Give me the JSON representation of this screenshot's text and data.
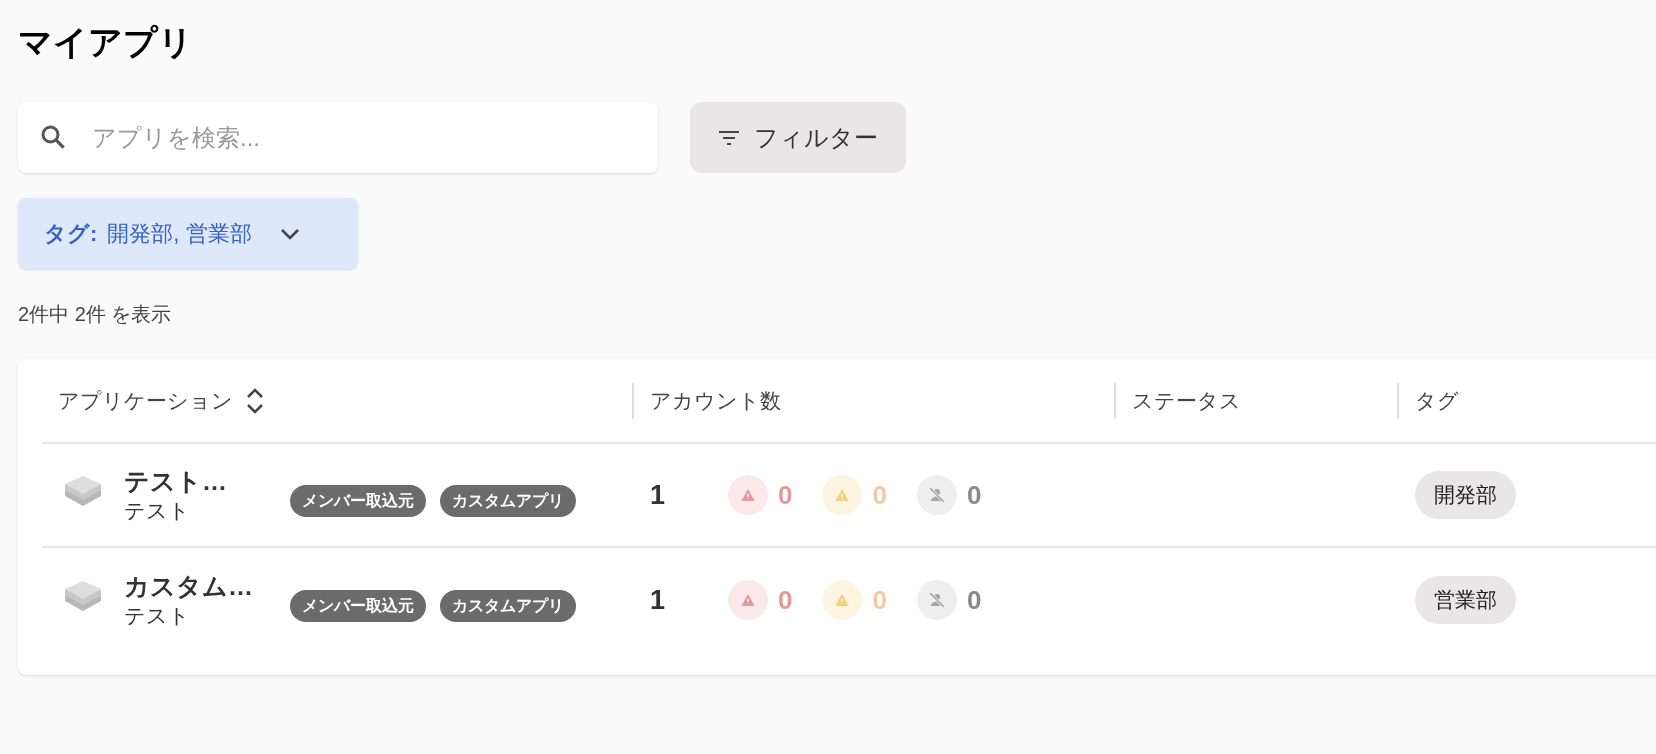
{
  "title": "マイアプリ",
  "search": {
    "placeholder": "アプリを検索..."
  },
  "filter_button": {
    "label": "フィルター"
  },
  "active_filter": {
    "label": "タグ:",
    "value": "開発部, 営業部"
  },
  "result_count": "2件中 2件 を表示",
  "table": {
    "columns": [
      "アプリケーション",
      "アカウント数",
      "ステータス",
      "タグ"
    ],
    "rows": [
      {
        "name": "テスト…",
        "subtitle": "テスト",
        "badges": [
          "メンバー取込元",
          "カスタムアプリ"
        ],
        "accounts": "1",
        "indicators": [
          {
            "kind": "error",
            "count": "0"
          },
          {
            "kind": "warning",
            "count": "0"
          },
          {
            "kind": "inactive",
            "count": "0"
          }
        ],
        "tag": "開発部"
      },
      {
        "name": "カスタム…",
        "subtitle": "テスト",
        "badges": [
          "メンバー取込元",
          "カスタムアプリ"
        ],
        "accounts": "1",
        "indicators": [
          {
            "kind": "error",
            "count": "0"
          },
          {
            "kind": "warning",
            "count": "0"
          },
          {
            "kind": "inactive",
            "count": "0"
          }
        ],
        "tag": "営業部"
      }
    ]
  }
}
